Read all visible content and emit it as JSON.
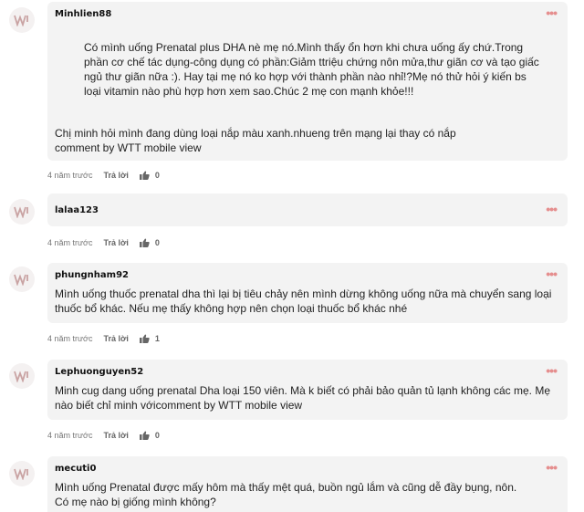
{
  "comments": [
    {
      "username": "Minhlien88",
      "quote": "Có mình uống Prenatal plus DHA nè mẹ nó.Mình thấy ổn hơn khi chưa uống ấy chứ.Trong\nphần cơ chế tác dụng-công dụng có phần:Giảm ttriệu chứng nôn mửa,thư giãn cơ và tạo giấc\nngủ thư giãn nữa :). Hay tại mẹ nó ko hợp với thành phần nào nhỉ!?Mẹ nó thử hỏi ý kiến bs\nloại vitamin nào phù hợp hơn xem sao.Chúc 2 mẹ con mạnh khỏe!!!",
      "text": "Chị minh hỏi mình đang dùng loại nắp màu xanh.nhueng trên mạng lại thay có nắp\ncomment by WTT mobile view",
      "time": "4 năm trước",
      "reply": "Trả lời",
      "likes": "0"
    },
    {
      "username": "lalaa123",
      "text": "",
      "time": "4 năm trước",
      "reply": "Trả lời",
      "likes": "0"
    },
    {
      "username": "phungnham92",
      "text": "Mình uống thuốc prenatal dha thì lại bị tiêu chảy nên mình dừng không uống nữa mà chuyển sang loại\nthuốc bổ khác. Nếu mẹ thấy không hợp nên chọn loại thuốc bổ khác nhé",
      "time": "4 năm trước",
      "reply": "Trả lời",
      "likes": "1"
    },
    {
      "username": "Lephuonguyen52",
      "text": "Minh cug dang uống prenatal Dha loại 150 viên. Mà k biết có phải bảo quản tủ lạnh không các mẹ. Mẹ\nnào biết chỉ minh vớicomment by WTT mobile view",
      "time": "4 năm trước",
      "reply": "Trả lời",
      "likes": "0"
    },
    {
      "username": "mecuti0",
      "text": "Mình uống Prenatal được mấy hôm mà thấy mệt quá, buồn ngủ lắm và cũng dễ đầy bụng, nôn.\nCó mẹ nào bị giống mình không?",
      "time": "",
      "reply": "",
      "likes": ""
    }
  ],
  "icons": {
    "avatar": "wtt-logo-icon",
    "more": "more-dots-icon",
    "like": "thumbs-up-icon"
  },
  "colors": {
    "accent": "#e58e8e",
    "bubble": "#f3f3f3",
    "avatar_bg": "#f4f1f1"
  }
}
